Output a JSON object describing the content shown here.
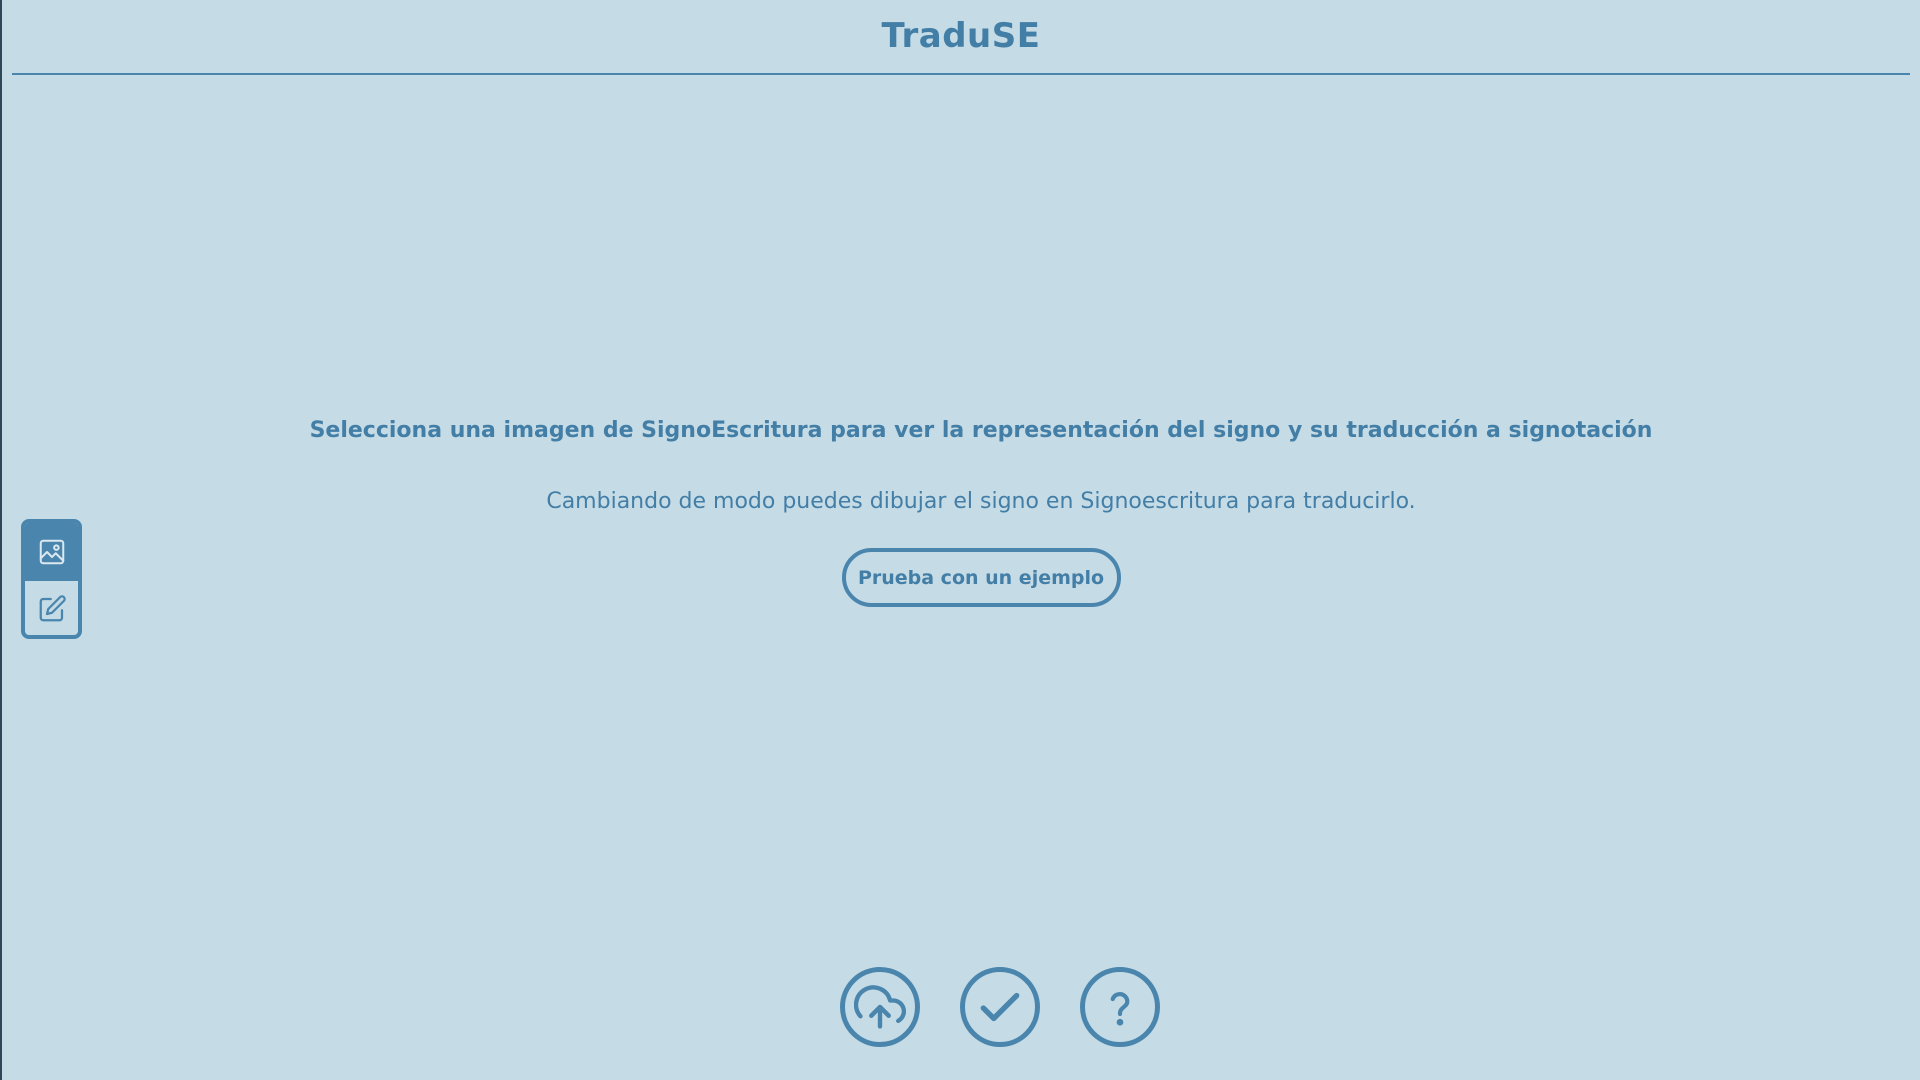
{
  "app": {
    "title": "TraduSE"
  },
  "mode_switch": {
    "modes": [
      {
        "name": "image",
        "icon": "image-icon",
        "active": true
      },
      {
        "name": "draw",
        "icon": "edit-icon",
        "active": false
      }
    ]
  },
  "main": {
    "instruction": "Selecciona una imagen de SignoEscritura para ver la representación del signo y su traducción a signotación",
    "subtext": "Cambiando de modo puedes dibujar el signo en Signoescritura para traducirlo.",
    "example_button_label": "Prueba con un ejemplo"
  },
  "toolbar": {
    "buttons": [
      {
        "icon": "upload-cloud-icon"
      },
      {
        "icon": "check-icon"
      },
      {
        "icon": "help-icon"
      }
    ]
  },
  "colors": {
    "background": "#c5dbe5",
    "accent": "#4a85ad",
    "text": "#437ea7"
  }
}
